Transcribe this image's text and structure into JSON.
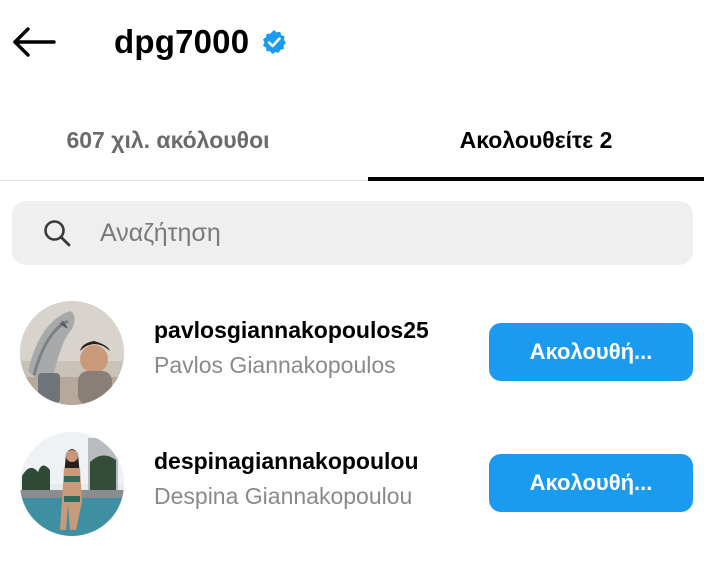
{
  "header": {
    "username": "dpg7000",
    "verified": true,
    "back_icon": "arrow-left-icon",
    "verified_icon": "verified-badge-icon"
  },
  "tabs": [
    {
      "label": "607 χιλ. ακόλουθοι",
      "active": false
    },
    {
      "label": "Ακολουθείτε 2",
      "active": true
    }
  ],
  "search": {
    "placeholder": "Αναζήτηση",
    "value": "",
    "icon": "search-icon"
  },
  "users": [
    {
      "handle": "pavlosgiannakopoulos25",
      "name": "Pavlos Giannakopoulos",
      "button_label": "Ακολουθή..."
    },
    {
      "handle": "despinagiannakopoulou",
      "name": "Despina Giannakopoulou",
      "button_label": "Ακολουθή..."
    }
  ],
  "colors": {
    "accent": "#1a9bf0",
    "verified": "#1a9bf0",
    "search_bg": "#efefef",
    "secondary_text": "#8a8a8a"
  }
}
